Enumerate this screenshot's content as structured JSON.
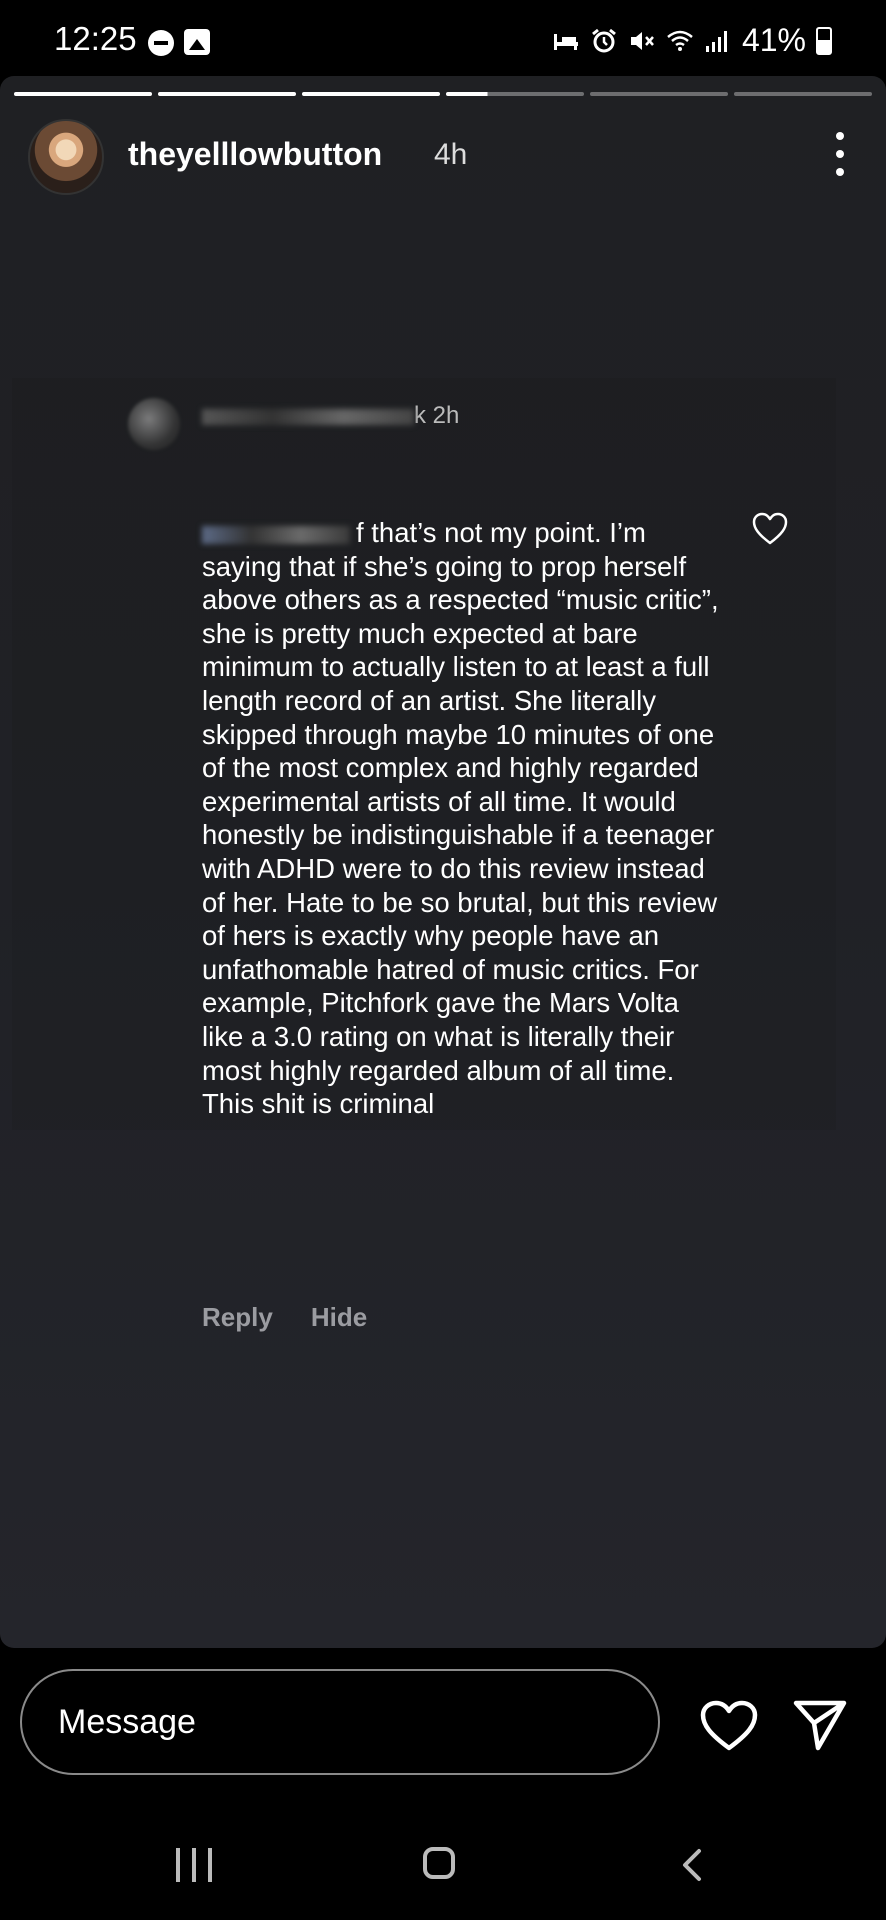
{
  "status_bar": {
    "time": "12:25",
    "battery": "41%",
    "icons": [
      "do-not-disturb-icon",
      "gallery-icon",
      "sleep-icon",
      "alarm-icon",
      "mute-icon",
      "wifi-icon",
      "signal-icon",
      "battery-icon"
    ]
  },
  "story": {
    "progress_segments": 6,
    "current_segment": 4,
    "username": "theyelllowbutton",
    "time_ago": "4h"
  },
  "comment": {
    "name_visible": "k",
    "time": "2h",
    "mention_suffix": "f",
    "text": "that’s not my point. I’m saying that if she’s going to prop herself above others as a respected “music critic”, she is pretty much expected at bare minimum to actually listen to at least a full length record of an artist. She literally skipped through maybe 10 minutes of one of the most complex and highly regarded experimental artists of all time. It would honestly be indistinguishable if a teenager with ADHD were to do this review instead of her. Hate to be so brutal, but this review of hers is exactly why people have an unfathomable hatred of music critics. For example, Pitchfork gave the Mars Volta like a 3.0 rating on what is literally their most highly regarded album of all time. This shit is criminal",
    "reply_label": "Reply",
    "hide_label": "Hide"
  },
  "message_bar": {
    "placeholder": "Message"
  },
  "colors": {
    "background": "#000000",
    "story_bg": "#202126",
    "secondary_text": "#9b9ca1"
  }
}
